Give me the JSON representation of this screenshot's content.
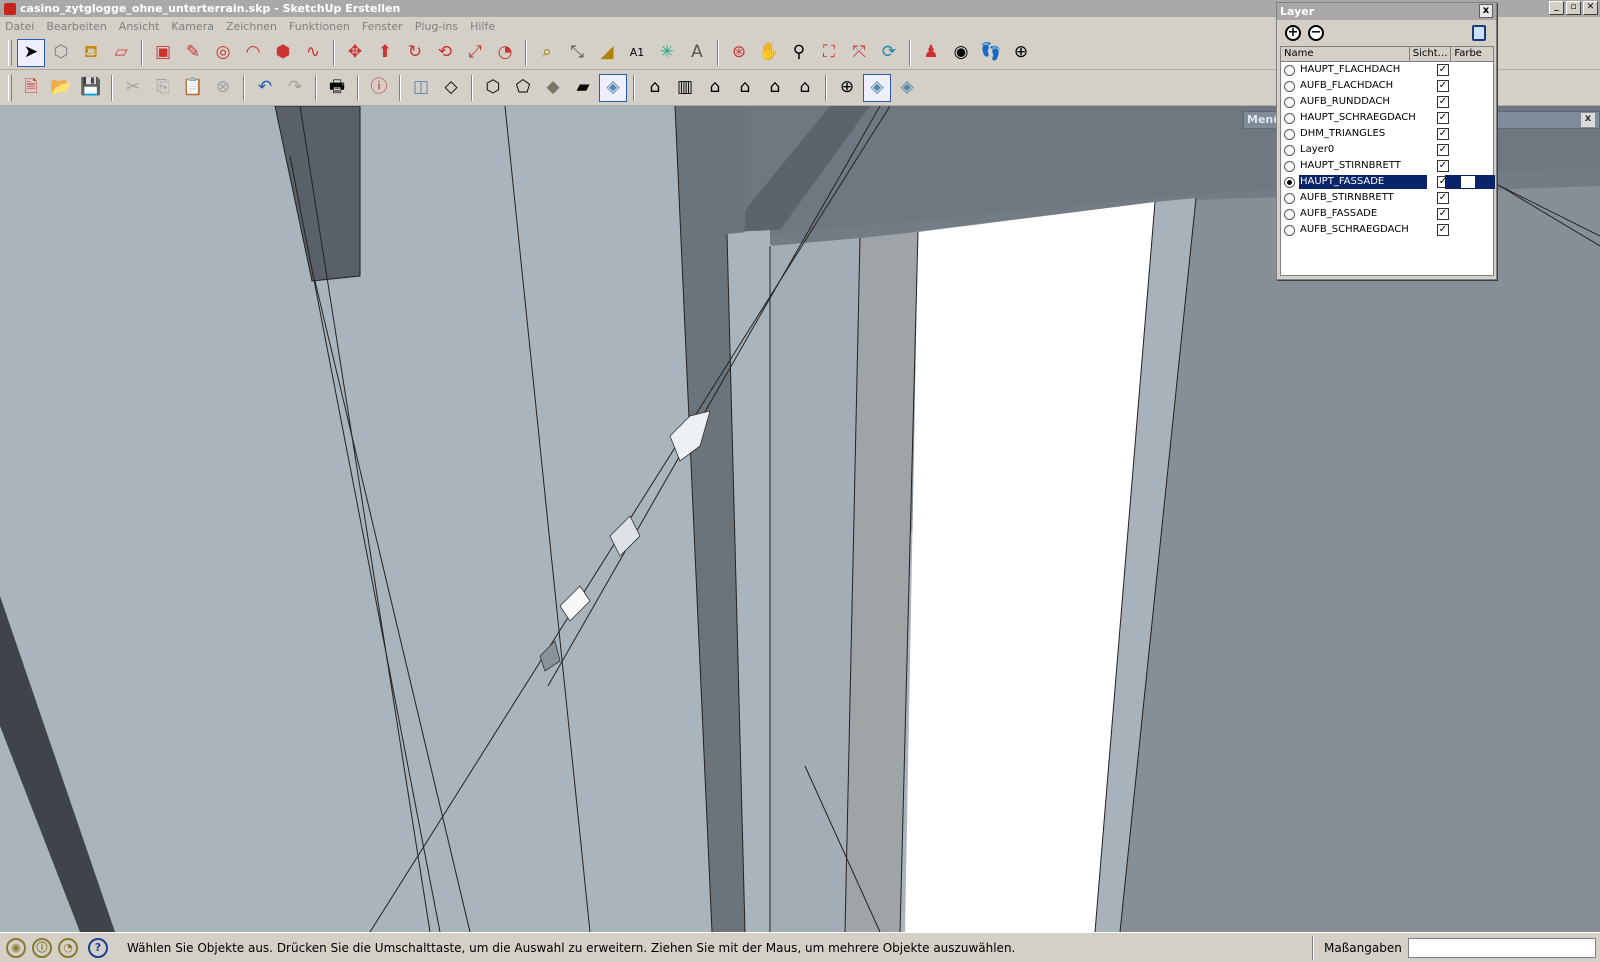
{
  "window": {
    "title": "casino_zytglogge_ohne_unterterrain.skp - SketchUp Erstellen",
    "controls": [
      "_",
      "▫",
      "✕"
    ]
  },
  "menubar": {
    "items": [
      "Datei",
      "Bearbeiten",
      "Ansicht",
      "Kamera",
      "Zeichnen",
      "Funktionen",
      "Fenster",
      "Plug-ins",
      "Hilfe"
    ]
  },
  "toolbar1": {
    "icons": [
      "select-icon",
      "make-component-icon",
      "paint-bucket-icon",
      "eraser-icon",
      "rectangle-icon",
      "pencil-icon",
      "circle-icon",
      "arc-icon",
      "polygon-icon",
      "freehand-icon",
      "move-icon",
      "push-pull-icon",
      "rotate-icon",
      "follow-me-icon",
      "scale-icon",
      "offset-icon",
      "tape-measure-icon",
      "dimension-icon",
      "protractor-icon",
      "text-icon",
      "axes-icon",
      "3d-text-icon",
      "orbit-icon",
      "pan-icon",
      "zoom-icon",
      "zoom-window-icon",
      "zoom-extents-icon",
      "previous-view-icon",
      "position-camera-icon",
      "look-around-icon",
      "walk-icon",
      "section-plane-icon"
    ]
  },
  "toolbar2": {
    "icons": [
      "new-icon",
      "open-icon",
      "save-icon",
      "cut-icon",
      "copy-icon",
      "paste-icon",
      "delete-icon",
      "undo-icon",
      "redo-icon",
      "print-icon",
      "model-info-icon",
      "xray-icon",
      "wireframe-icon",
      "hidden-line-icon",
      "shaded-icon",
      "shaded-textures-icon",
      "monochrome-icon",
      "iso-view-icon",
      "top-view-icon",
      "front-view-icon",
      "right-view-icon",
      "back-view-icon",
      "left-view-icon",
      "section-display-icon",
      "section-cuts-icon",
      "section-fill-icon"
    ]
  },
  "layer_panel": {
    "title": "Layer",
    "close": "x",
    "add": "+",
    "remove": "−",
    "columns": {
      "name": "Name",
      "visible": "Sicht…",
      "color": "Farbe"
    },
    "layers": [
      {
        "name": "HAUPT_FLACHDACH",
        "active": false,
        "visible": true,
        "selected": false
      },
      {
        "name": "AUFB_FLACHDACH",
        "active": false,
        "visible": true,
        "selected": false
      },
      {
        "name": "AUFB_RUNDDACH",
        "active": false,
        "visible": true,
        "selected": false
      },
      {
        "name": "HAUPT_SCHRAEGDACH",
        "active": false,
        "visible": true,
        "selected": false
      },
      {
        "name": "DHM_TRIANGLES",
        "active": false,
        "visible": true,
        "selected": false
      },
      {
        "name": "Layer0",
        "active": false,
        "visible": true,
        "selected": false
      },
      {
        "name": "HAUPT_STIRNBRETT",
        "active": false,
        "visible": true,
        "selected": false
      },
      {
        "name": "HAUPT_FASSADE",
        "active": true,
        "visible": true,
        "selected": true
      },
      {
        "name": "AUFB_STIRNBRETT",
        "active": false,
        "visible": true,
        "selected": false
      },
      {
        "name": "AUFB_FASSADE",
        "active": false,
        "visible": true,
        "selected": false
      },
      {
        "name": "AUFB_SCHRAEGDACH",
        "active": false,
        "visible": true,
        "selected": false
      }
    ]
  },
  "menu_stub": {
    "label": "Menü",
    "close": "x"
  },
  "statusbar": {
    "text": "Wählen Sie Objekte aus. Drücken Sie die Umschalttaste, um die Auswahl zu erweitern. Ziehen Sie mit der Maus, um mehrere Objekte auszuwählen.",
    "measure_label": "Maßangaben",
    "measure_value": ""
  },
  "colors": {
    "selection": "#0a246a",
    "face_light": "#aab4bc",
    "face_dark": "#6f7880",
    "face_white": "#ffffff"
  }
}
